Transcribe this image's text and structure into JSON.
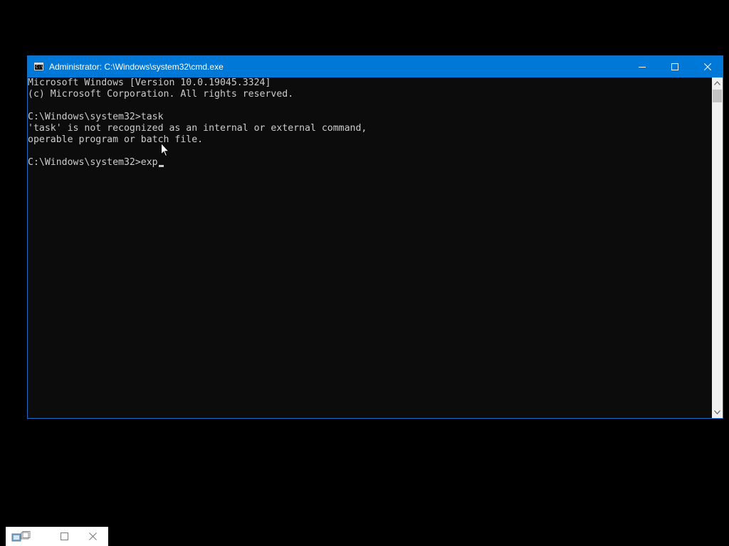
{
  "window": {
    "title": "Administrator: C:\\Windows\\system32\\cmd.exe",
    "icon": "cmd-icon",
    "icon_glyph": "C:\\",
    "titlebar_color": "#0078d7",
    "buttons": {
      "minimize": "minimize-icon",
      "maximize": "maximize-icon",
      "close": "close-icon"
    }
  },
  "console": {
    "background": "#0c0c0c",
    "foreground": "#cccccc",
    "lines": [
      "Microsoft Windows [Version 10.0.19045.3324]",
      "(c) Microsoft Corporation. All rights reserved.",
      "",
      "C:\\Windows\\system32>task",
      "'task' is not recognized as an internal or external command,",
      "operable program or batch file.",
      "",
      "C:\\Windows\\system32>exp"
    ]
  },
  "scrollbar": {
    "up": "chevron-up-icon",
    "down": "chevron-down-icon"
  },
  "minimized_window": {
    "icons": [
      "app-icon",
      "restore-icon",
      "close-icon"
    ]
  }
}
